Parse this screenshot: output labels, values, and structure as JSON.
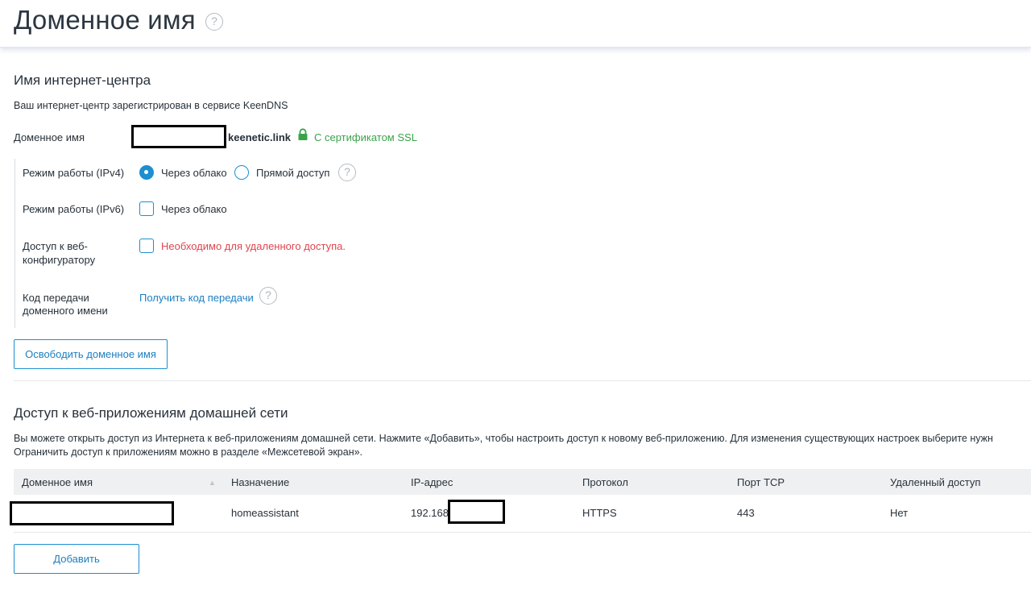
{
  "header": {
    "title": "Доменное имя",
    "help_glyph": "?"
  },
  "router_name": {
    "section_title": "Имя интернет-центра",
    "registered_text": "Ваш интернет-центр зарегистрирован в сервисе KeenDNS",
    "domain_label": "Доменное имя",
    "domain_suffix": "keenetic.link",
    "ssl_text": "С сертификатом SSL",
    "ipv4_label": "Режим работы (IPv4)",
    "ipv4_options": [
      "Через облако",
      "Прямой доступ"
    ],
    "ipv4_selected": "Через облако",
    "ipv6_label": "Режим работы (IPv6)",
    "ipv6_option": "Через облако",
    "ipv6_checked": false,
    "web_access_label_1": "Доступ к веб-",
    "web_access_label_2": "конфигуратору",
    "web_access_checked": false,
    "web_access_note": "Необходимо для удаленного доступа.",
    "transfer_label_1": "Код передачи",
    "transfer_label_2": "доменного имени",
    "transfer_link": "Получить код передачи",
    "release_button": "Освободить доменное имя"
  },
  "web_apps": {
    "section_title": "Доступ к веб-приложениям домашней сети",
    "description_1": "Вы можете открыть доступ из Интернета к веб-приложениям домашней сети. Нажмите «Добавить», чтобы настроить доступ к новому веб-приложению. Для изменения существующих настроек выберите нужн",
    "description_2": "Ограничить доступ к приложениям можно в разделе «Межсетевой экран».",
    "columns": [
      "Доменное имя",
      "Назначение",
      "IP-адрес",
      "Протокол",
      "Порт TCP",
      "Удаленный доступ"
    ],
    "sort_glyph": "▲",
    "rows": [
      {
        "domain": "",
        "purpose": "homeassistant",
        "ip": "192.168",
        "protocol": "HTTPS",
        "port": "443",
        "remote": "Нет"
      }
    ],
    "add_button": "Добавить"
  },
  "colors": {
    "accent": "#1c8fd1",
    "ssl_green": "#3aa34a",
    "warning_red": "#e0454f"
  },
  "icons": {
    "ssl": "lock-icon",
    "help": "help-circle-icon",
    "sort": "sort-asc-icon"
  }
}
